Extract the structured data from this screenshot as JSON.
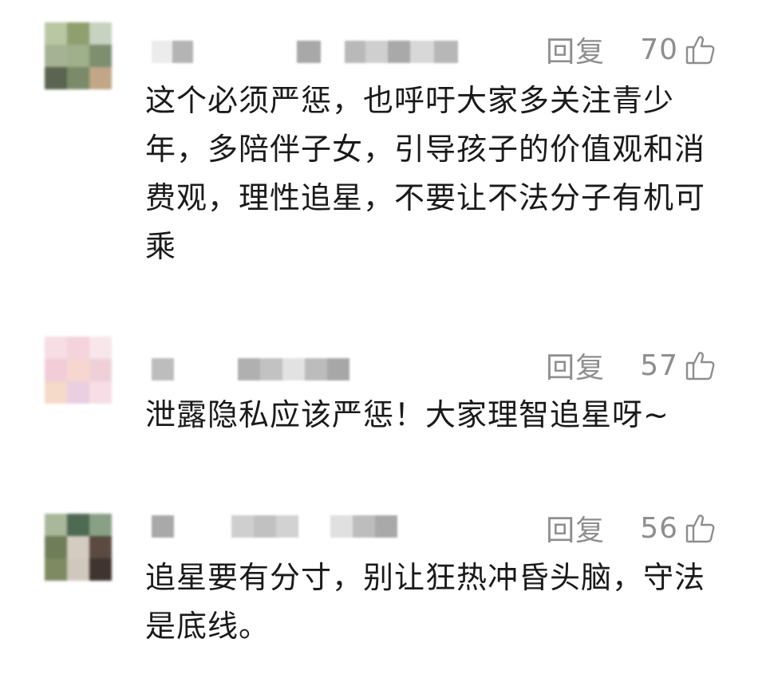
{
  "comments": [
    {
      "reply_label": "回复",
      "likes": "70",
      "text": "这个必须严惩，也呼吁大家多关注青少年，多陪伴子女，引导孩子的价值观和消费观，理性追星，不要让不法分子有机可乘",
      "avatar_colors": [
        "#b9c7a3",
        "#8f9f6e",
        "#c8d2c0",
        "#a6b294",
        "#9fb08a",
        "#7e8f70",
        "#5a6450",
        "#7b8b6a",
        "#c1a687"
      ]
    },
    {
      "reply_label": "回复",
      "likes": "57",
      "text": "泄露隐私应该严惩！大家理智追星呀~",
      "avatar_colors": [
        "#f7dde4",
        "#f4d3dc",
        "#f8e6ea",
        "#f2ccd6",
        "#f6d6cf",
        "#efd0d8",
        "#f5d9c9",
        "#e9cfe0",
        "#f6dde6"
      ]
    },
    {
      "reply_label": "回复",
      "likes": "56",
      "text": "追星要有分寸，别让狂热冲昏头脑，守法是底线。",
      "avatar_colors": [
        "#a9b79a",
        "#4f6a52",
        "#8aa086",
        "#6f7d58",
        "#d4ccc0",
        "#5a4a42",
        "#7d8a62",
        "#cfc8bc",
        "#3f3430"
      ]
    }
  ],
  "colors": {
    "text": "#1a1a1a",
    "meta": "#8e8e8e",
    "background": "#ffffff"
  },
  "icons": {
    "like": "thumbs-up-icon"
  }
}
